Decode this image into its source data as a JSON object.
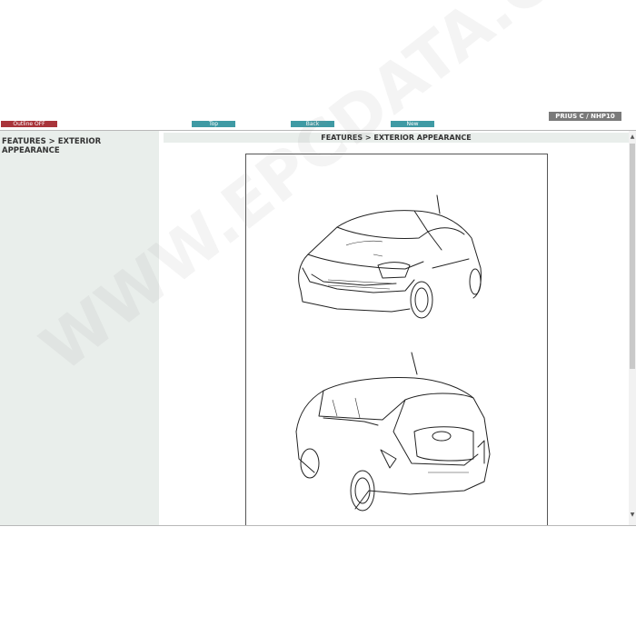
{
  "toolbar": {
    "outline_label": "Outline OFF",
    "top_label": "Top",
    "back_label": "Back",
    "new_label": "New"
  },
  "model": "PRIUS C / NHP10",
  "sidebar": {
    "title": "FEATURES > EXTERIOR APPEARANCE"
  },
  "main": {
    "header": "FEATURES > EXTERIOR APPEARANCE"
  },
  "watermark": "WWW.EPCDATA.COM",
  "colors": {
    "outline_button": "#a8343a",
    "nav_button": "#3f9aa4",
    "model_badge": "#7a7a7a",
    "panel_bg": "#e9eeeb"
  }
}
